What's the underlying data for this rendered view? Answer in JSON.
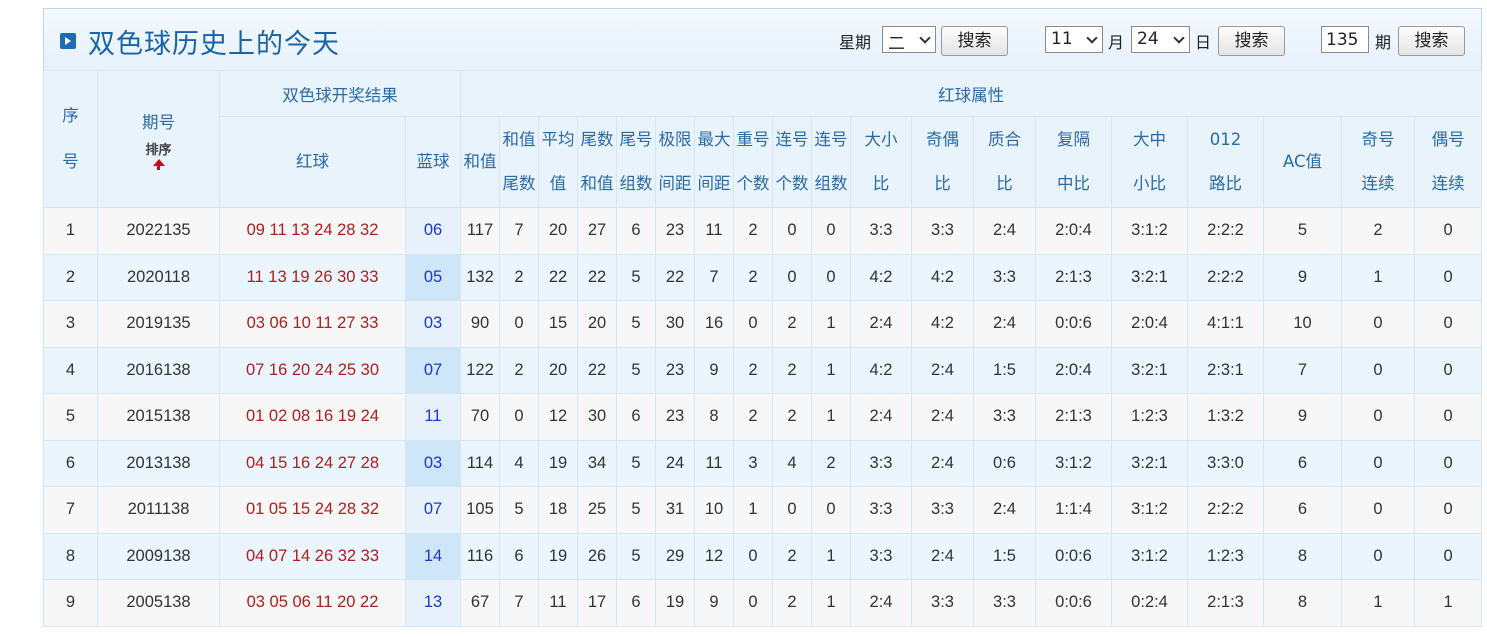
{
  "title": "双色球历史上的今天",
  "search": {
    "weekday_label": "星期",
    "weekday_value": "二",
    "search_label": "搜索",
    "month_value": "11",
    "month_label": "月",
    "day_value": "24",
    "day_label": "日",
    "issue_value": "135",
    "issue_label": "期"
  },
  "headers": {
    "seq": "序号",
    "seq_a": "序",
    "seq_b": "号",
    "issue": "期号",
    "sort": "排序",
    "result_group": "双色球开奖结果",
    "red_attr_group": "红球属性",
    "red": "红球",
    "blue": "蓝球",
    "sum": "和值",
    "sum_tail_a": "和值",
    "sum_tail_b": "尾数",
    "avg_a": "平均",
    "avg_b": "值",
    "tail_sum_a": "尾数",
    "tail_sum_b": "和值",
    "tail_group_a": "尾号",
    "tail_group_b": "组数",
    "range_a": "极限",
    "range_b": "间距",
    "max_gap_a": "最大",
    "max_gap_b": "间距",
    "repeat_a": "重号",
    "repeat_b": "个数",
    "consec_a": "连号",
    "consec_b": "个数",
    "consec_group_a": "连号",
    "consec_group_b": "组数",
    "size_a": "大小",
    "size_b": "比",
    "oddeven_a": "奇偶",
    "oddeven_b": "比",
    "prime_a": "质合",
    "prime_b": "比",
    "gap_a": "复隔",
    "gap_b": "中比",
    "bigmid_a": "大中",
    "bigmid_b": "小比",
    "road_a": "012",
    "road_b": "路比",
    "ac": "AC值",
    "odd_consec_a": "奇号",
    "odd_consec_b": "连续",
    "even_consec_a": "偶号",
    "even_consec_b": "连续"
  },
  "rows": [
    [
      "1",
      "2022135",
      "09 11 13 24 28 32",
      "06",
      "117",
      "7",
      "20",
      "27",
      "6",
      "23",
      "11",
      "2",
      "0",
      "0",
      "3:3",
      "3:3",
      "2:4",
      "2:0:4",
      "3:1:2",
      "2:2:2",
      "5",
      "2",
      "0"
    ],
    [
      "2",
      "2020118",
      "11 13 19 26 30 33",
      "05",
      "132",
      "2",
      "22",
      "22",
      "5",
      "22",
      "7",
      "2",
      "0",
      "0",
      "4:2",
      "4:2",
      "3:3",
      "2:1:3",
      "3:2:1",
      "2:2:2",
      "9",
      "1",
      "0"
    ],
    [
      "3",
      "2019135",
      "03 06 10 11 27 33",
      "03",
      "90",
      "0",
      "15",
      "20",
      "5",
      "30",
      "16",
      "0",
      "2",
      "1",
      "2:4",
      "4:2",
      "2:4",
      "0:0:6",
      "2:0:4",
      "4:1:1",
      "10",
      "0",
      "0"
    ],
    [
      "4",
      "2016138",
      "07 16 20 24 25 30",
      "07",
      "122",
      "2",
      "20",
      "22",
      "5",
      "23",
      "9",
      "2",
      "2",
      "1",
      "4:2",
      "2:4",
      "1:5",
      "2:0:4",
      "3:2:1",
      "2:3:1",
      "7",
      "0",
      "0"
    ],
    [
      "5",
      "2015138",
      "01 02 08 16 19 24",
      "11",
      "70",
      "0",
      "12",
      "30",
      "6",
      "23",
      "8",
      "2",
      "2",
      "1",
      "2:4",
      "2:4",
      "3:3",
      "2:1:3",
      "1:2:3",
      "1:3:2",
      "9",
      "0",
      "0"
    ],
    [
      "6",
      "2013138",
      "04 15 16 24 27 28",
      "03",
      "114",
      "4",
      "19",
      "34",
      "5",
      "24",
      "11",
      "3",
      "4",
      "2",
      "3:3",
      "2:4",
      "0:6",
      "3:1:2",
      "3:2:1",
      "3:3:0",
      "6",
      "0",
      "0"
    ],
    [
      "7",
      "2011138",
      "01 05 15 24 28 32",
      "07",
      "105",
      "5",
      "18",
      "25",
      "5",
      "31",
      "10",
      "1",
      "0",
      "0",
      "3:3",
      "3:3",
      "2:4",
      "1:1:4",
      "3:1:2",
      "2:2:2",
      "6",
      "0",
      "0"
    ],
    [
      "8",
      "2009138",
      "04 07 14 26 32 33",
      "14",
      "116",
      "6",
      "19",
      "26",
      "5",
      "29",
      "12",
      "0",
      "2",
      "1",
      "3:3",
      "2:4",
      "1:5",
      "0:0:6",
      "3:1:2",
      "1:2:3",
      "8",
      "0",
      "0"
    ],
    [
      "9",
      "2005138",
      "03 05 06 11 20 22",
      "13",
      "67",
      "7",
      "11",
      "17",
      "6",
      "19",
      "9",
      "0",
      "2",
      "1",
      "2:4",
      "3:3",
      "3:3",
      "0:0:6",
      "0:2:4",
      "2:1:3",
      "8",
      "1",
      "1"
    ]
  ]
}
